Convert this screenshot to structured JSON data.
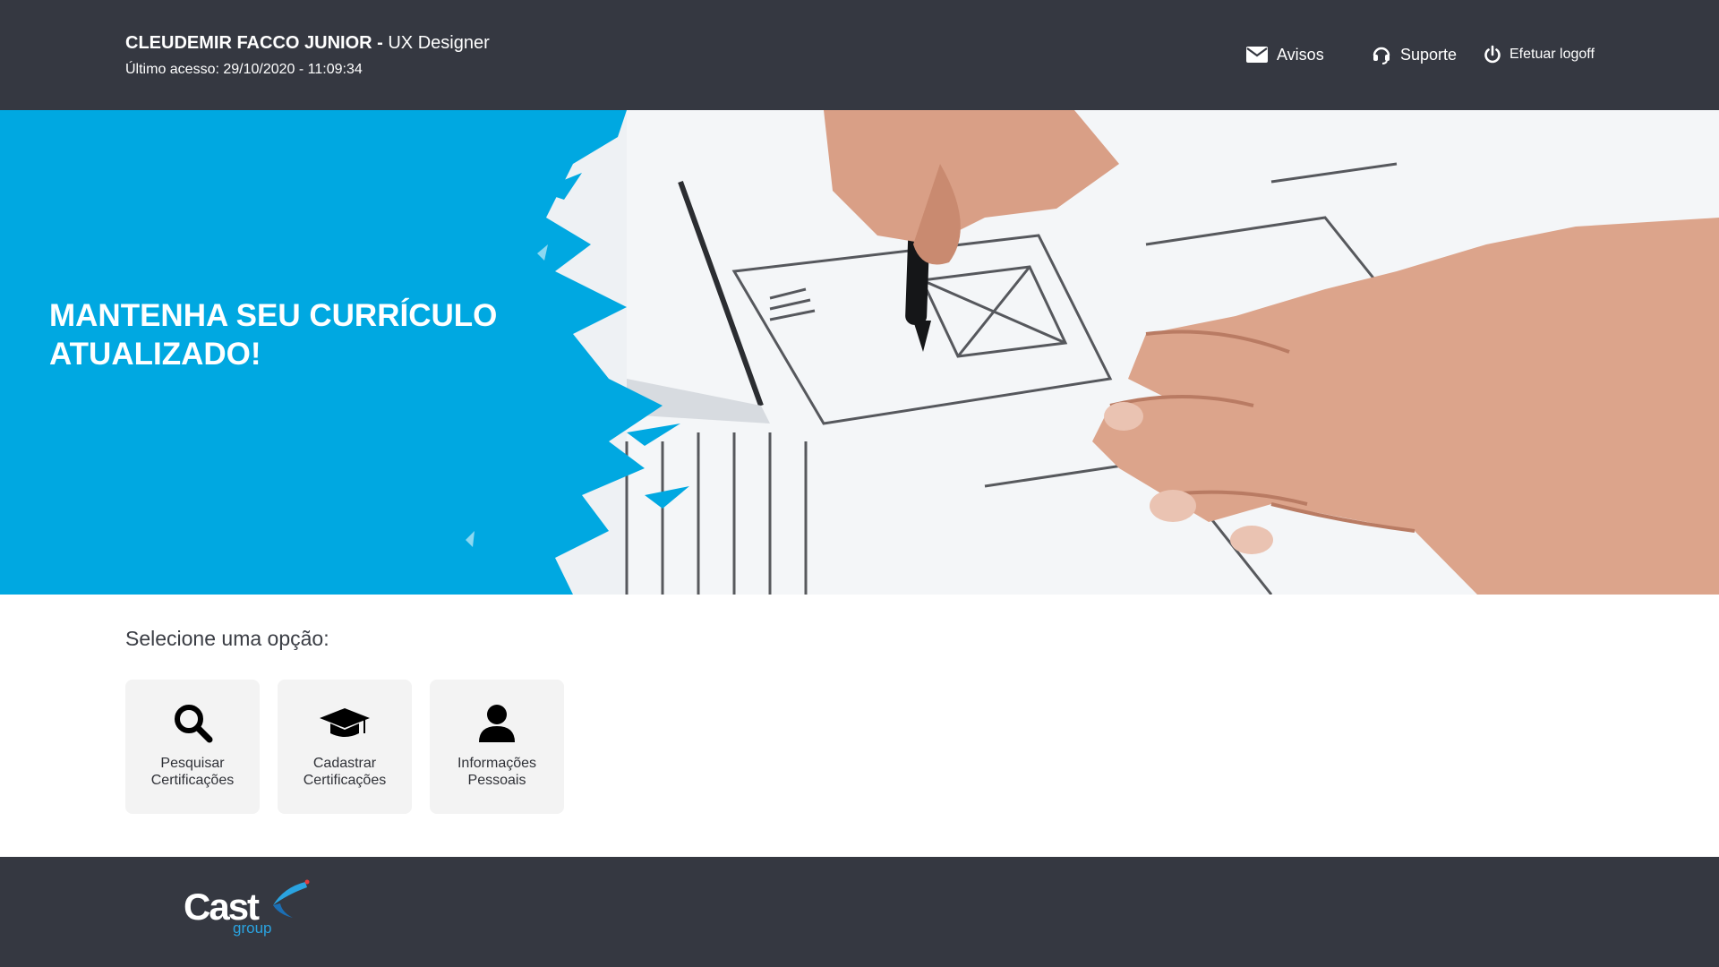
{
  "header": {
    "user_name": "CLEUDEMIR FACCO JUNIOR -",
    "user_role": "UX Designer",
    "last_access": "Último acesso: 29/10/2020 - 11:09:34",
    "nav": {
      "avisos": {
        "label": "Avisos",
        "icon": "envelope-icon"
      },
      "suporte": {
        "label": "Suporte",
        "icon": "headset-icon"
      },
      "logoff": {
        "label": "Efetuar logoff",
        "icon": "power-icon"
      }
    }
  },
  "hero": {
    "title": "MANTENHA SEU CURRÍCULO\nATUALIZADO!",
    "accent_color": "#00a8e1",
    "image": "hand-drawing-wireframe-photo"
  },
  "options": {
    "prompt": "Selecione uma opção:",
    "cards": [
      {
        "label": "Pesquisar\nCertificações",
        "icon": "search-icon"
      },
      {
        "label": "Cadastrar\nCertificações",
        "icon": "graduation-cap-icon"
      },
      {
        "label": "Informações\nPessoais",
        "icon": "user-icon"
      }
    ]
  },
  "footer": {
    "logo_main": "Cast",
    "logo_sub": "group",
    "logo_color": "#2aa3e0"
  },
  "colors": {
    "dark_bar": "#353841",
    "card_bg": "#f3f3f3",
    "text_dark": "#2f3137"
  }
}
